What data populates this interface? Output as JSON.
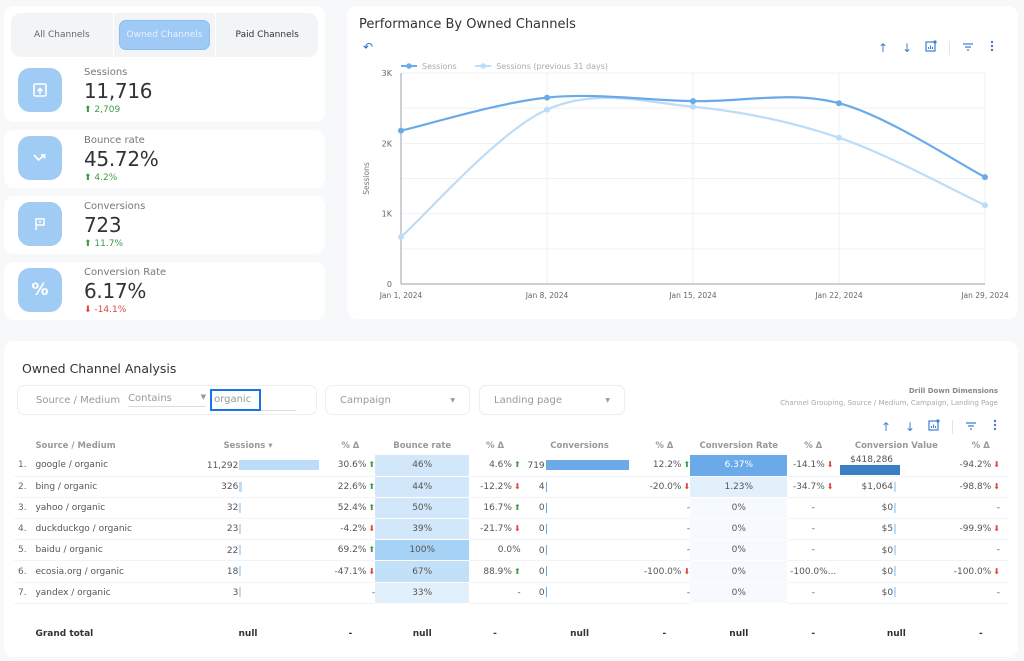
{
  "channel_tabs": [
    {
      "label": "All Channels",
      "active": false
    },
    {
      "label": "Owned Channels",
      "active": true
    },
    {
      "label": "Paid Channels",
      "active": false
    }
  ],
  "kpis": [
    {
      "icon": "upload-box-icon",
      "label": "Sessions",
      "value": "11,716",
      "delta": "2,709",
      "direction": "up"
    },
    {
      "icon": "trend-down-right-icon",
      "label": "Bounce rate",
      "value": "45.72%",
      "delta": "4.2%",
      "direction": "up"
    },
    {
      "icon": "flag-icon",
      "label": "Conversions",
      "value": "723",
      "delta": "11.7%",
      "direction": "up"
    },
    {
      "icon": "percent-icon",
      "label": "Conversion Rate",
      "value": "6.17%",
      "delta": "-14.1%",
      "direction": "down"
    }
  ],
  "chart": {
    "title": "Performance By Owned Channels",
    "colors": {
      "current": "#6aaae9",
      "previous": "#bcdcf7"
    }
  },
  "chart_data": {
    "type": "line",
    "title": "Performance By Owned Channels",
    "x": [
      "Jan 1, 2024",
      "Jan 8, 2024",
      "Jan 15, 2024",
      "Jan 22, 2024",
      "Jan 29, 2024"
    ],
    "series": [
      {
        "name": "Sessions",
        "values": [
          2180,
          2650,
          2600,
          2570,
          1520
        ]
      },
      {
        "name": "Sessions (previous 31 days)",
        "values": [
          670,
          2480,
          2520,
          2080,
          1120
        ]
      }
    ],
    "xlabel": "",
    "ylabel": "Sessions",
    "ylim": [
      0,
      3000
    ],
    "yticks": [
      "0",
      "1K",
      "2K",
      "3K"
    ],
    "grid": true,
    "legend": "top-left"
  },
  "table_section": {
    "title": "Owned Channel Analysis",
    "filter": {
      "dimension": "Source / Medium",
      "operator": "Contains",
      "value": "organic"
    },
    "campaign_placeholder": "Campaign",
    "landing_placeholder": "Landing page",
    "drill_title": "Drill Down Dimensions",
    "drill_dims": "Channel Grouping, Source / Medium, Campaign, Landing Page",
    "headers": [
      "Source / Medium",
      "Sessions ▾",
      "% Δ",
      "Bounce rate",
      "% Δ",
      "Conversions",
      "% Δ",
      "Conversion Rate",
      "% Δ",
      "Conversion Value",
      "% Δ"
    ],
    "rows": [
      {
        "idx": "1.",
        "source": "google / organic",
        "sessions": "11,292",
        "sessions_frac": 1.0,
        "s_delta": "30.6%",
        "s_dir": "up",
        "bounce": "46%",
        "bounce_frac": 0.46,
        "b_delta": "4.6%",
        "b_dir": "up",
        "conv": "719",
        "conv_frac": 1.0,
        "c_delta": "12.2%",
        "c_dir": "up",
        "rate": "6.37%",
        "rate_frac": 1.0,
        "r_delta": "-14.1%",
        "r_dir": "down",
        "value": "$418,286",
        "value_frac": 1.0,
        "v_delta": "-94.2%",
        "v_dir": "down"
      },
      {
        "idx": "2.",
        "source": "bing / organic",
        "sessions": "326",
        "sessions_frac": 0.03,
        "s_delta": "22.6%",
        "s_dir": "up",
        "bounce": "44%",
        "bounce_frac": 0.44,
        "b_delta": "-12.2%",
        "b_dir": "down",
        "conv": "4",
        "conv_frac": 0.006,
        "c_delta": "-20.0%",
        "c_dir": "down",
        "rate": "1.23%",
        "rate_frac": 0.19,
        "r_delta": "-34.7%",
        "r_dir": "down",
        "value": "$1,064",
        "value_frac": 0.003,
        "v_delta": "-98.8%",
        "v_dir": "down"
      },
      {
        "idx": "3.",
        "source": "yahoo / organic",
        "sessions": "32",
        "sessions_frac": 0.003,
        "s_delta": "52.4%",
        "s_dir": "up",
        "bounce": "50%",
        "bounce_frac": 0.5,
        "b_delta": "16.7%",
        "b_dir": "up",
        "conv": "0",
        "conv_frac": 0,
        "c_delta": "-",
        "c_dir": "",
        "rate": "0%",
        "rate_frac": 0,
        "r_delta": "-",
        "r_dir": "",
        "value": "$0",
        "value_frac": 0,
        "v_delta": "-",
        "v_dir": ""
      },
      {
        "idx": "4.",
        "source": "duckduckgo / organic",
        "sessions": "23",
        "sessions_frac": 0.002,
        "s_delta": "-4.2%",
        "s_dir": "down",
        "bounce": "39%",
        "bounce_frac": 0.39,
        "b_delta": "-21.7%",
        "b_dir": "down",
        "conv": "0",
        "conv_frac": 0,
        "c_delta": "-",
        "c_dir": "",
        "rate": "0%",
        "rate_frac": 0,
        "r_delta": "-",
        "r_dir": "",
        "value": "$5",
        "value_frac": 0,
        "v_delta": "-99.9%",
        "v_dir": "down"
      },
      {
        "idx": "5.",
        "source": "baidu / organic",
        "sessions": "22",
        "sessions_frac": 0.002,
        "s_delta": "69.2%",
        "s_dir": "up",
        "bounce": "100%",
        "bounce_frac": 1.0,
        "b_delta": "0.0%",
        "b_dir": "",
        "conv": "0",
        "conv_frac": 0,
        "c_delta": "-",
        "c_dir": "",
        "rate": "0%",
        "rate_frac": 0,
        "r_delta": "-",
        "r_dir": "",
        "value": "$0",
        "value_frac": 0,
        "v_delta": "-",
        "v_dir": ""
      },
      {
        "idx": "6.",
        "source": "ecosia.org / organic",
        "sessions": "18",
        "sessions_frac": 0.002,
        "s_delta": "-47.1%",
        "s_dir": "down",
        "bounce": "67%",
        "bounce_frac": 0.67,
        "b_delta": "88.9%",
        "b_dir": "up",
        "conv": "0",
        "conv_frac": 0,
        "c_delta": "-100.0%",
        "c_dir": "down",
        "rate": "0%",
        "rate_frac": 0,
        "r_delta": "-100.0%...",
        "r_dir": "",
        "value": "$0",
        "value_frac": 0,
        "v_delta": "-100.0%",
        "v_dir": "down"
      },
      {
        "idx": "7.",
        "source": "yandex / organic",
        "sessions": "3",
        "sessions_frac": 0.0003,
        "s_delta": "-",
        "s_dir": "",
        "bounce": "33%",
        "bounce_frac": 0.33,
        "b_delta": "-",
        "b_dir": "",
        "conv": "0",
        "conv_frac": 0,
        "c_delta": "-",
        "c_dir": "",
        "rate": "0%",
        "rate_frac": 0,
        "r_delta": "-",
        "r_dir": "",
        "value": "$0",
        "value_frac": 0,
        "v_delta": "-",
        "v_dir": ""
      }
    ],
    "total": {
      "label": "Grand total",
      "sessions": "null",
      "s_delta": "-",
      "bounce": "null",
      "b_delta": "-",
      "conv": "null",
      "c_delta": "-",
      "rate": "null",
      "r_delta": "-",
      "value": "null",
      "v_delta": "-"
    }
  }
}
